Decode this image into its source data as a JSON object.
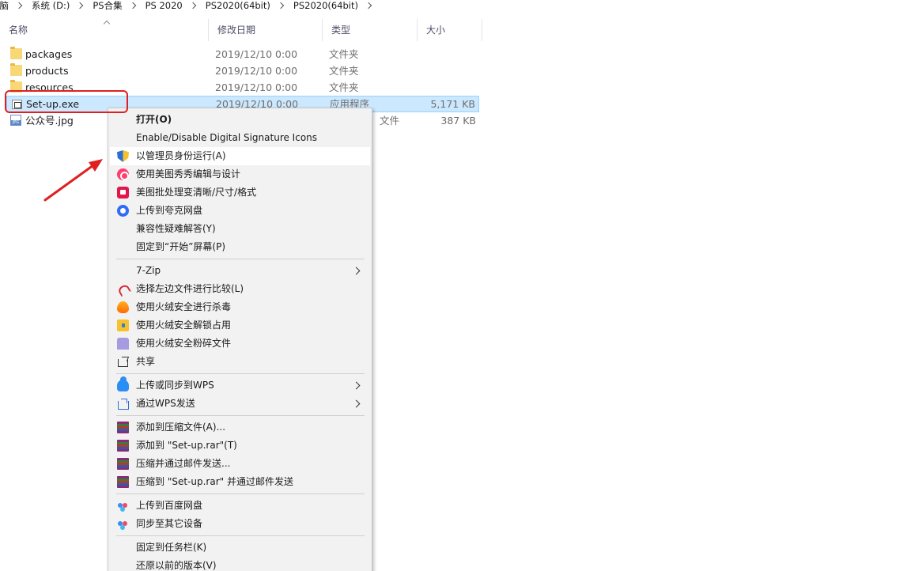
{
  "breadcrumb": [
    "电脑",
    "系统 (D:)",
    "PS合集",
    "PS 2020",
    "PS2020(64bit)",
    "PS2020(64bit)"
  ],
  "columns": {
    "name": "名称",
    "date": "修改日期",
    "type": "类型",
    "size": "大小"
  },
  "files": [
    {
      "name": "packages",
      "date": "2019/12/10 0:00",
      "type": "文件夹",
      "size": "",
      "icon": "folder-icon"
    },
    {
      "name": "products",
      "date": "2019/12/10 0:00",
      "type": "文件夹",
      "size": "",
      "icon": "folder-icon"
    },
    {
      "name": "resources",
      "date": "2019/12/10 0:00",
      "type": "文件夹",
      "size": "",
      "icon": "folder-icon"
    },
    {
      "name": "Set-up.exe",
      "date": "2019/12/10 0:00",
      "type": "应用程序",
      "size": "5,171 KB",
      "icon": "exe-icon",
      "selected": true
    },
    {
      "name": "公众号.jpg",
      "date": "",
      "type": "文件",
      "size": "387 KB",
      "icon": "jpg-icon"
    }
  ],
  "menu": {
    "open": "打开(O)",
    "signature": "Enable/Disable Digital Signature Icons",
    "run_as_admin": "以管理员身份运行(A)",
    "meitu_edit": "使用美图秀秀编辑与设计",
    "meitu_batch": "美图批处理变清晰/尺寸/格式",
    "quark_upload": "上传到夸克网盘",
    "compat": "兼容性疑难解答(Y)",
    "pin_start": "固定到“开始”屏幕(P)",
    "zip7": "7-Zip",
    "compare": "选择左边文件进行比较(L)",
    "huorong_scan": "使用火绒安全进行杀毒",
    "huorong_unlock": "使用火绒安全解锁占用",
    "huorong_shred": "使用火绒安全粉碎文件",
    "share": "共享",
    "wps_sync": "上传或同步到WPS",
    "wps_send": "通过WPS发送",
    "rar_add": "添加到压缩文件(A)...",
    "rar_add_named": "添加到 \"Set-up.rar\"(T)",
    "rar_email": "压缩并通过邮件发送...",
    "rar_email_named": "压缩到 \"Set-up.rar\" 并通过邮件发送",
    "baidu_upload": "上传到百度网盘",
    "baidu_sync": "同步至其它设备",
    "pin_taskbar": "固定到任务栏(K)",
    "restore": "还原以前的版本(V)"
  },
  "colors": {
    "selection": "#cce8ff",
    "annotation": "#e02020",
    "menu_bg": "#f2f2f2"
  }
}
